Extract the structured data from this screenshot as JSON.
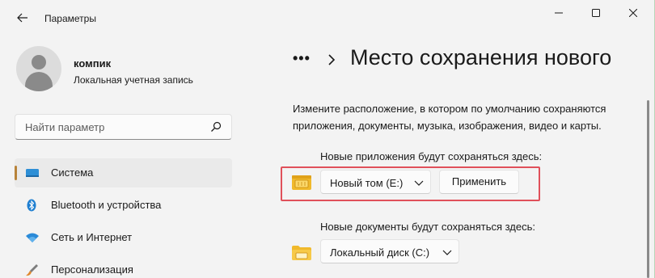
{
  "app": {
    "title": "Параметры"
  },
  "user": {
    "name": "компик",
    "account_type": "Локальная учетная запись"
  },
  "search": {
    "placeholder": "Найти параметр"
  },
  "sidebar": {
    "items": [
      {
        "label": "Система",
        "icon": "monitor-icon",
        "active": true
      },
      {
        "label": "Bluetooth и устройства",
        "icon": "bluetooth-icon",
        "active": false
      },
      {
        "label": "Сеть и Интернет",
        "icon": "wifi-icon",
        "active": false
      },
      {
        "label": "Персонализация",
        "icon": "brush-icon",
        "active": false
      }
    ]
  },
  "main": {
    "breadcrumb_overflow": "•••",
    "title": "Место сохранения нового",
    "description": "Измените расположение, в котором по умолчанию сохраняются приложения, документы, музыка, изображения, видео и карты.",
    "apps_section": {
      "label": "Новые приложения будут сохраняться здесь:",
      "selected_drive": "Новый том (E:)",
      "apply_label": "Применить"
    },
    "docs_section": {
      "label": "Новые документы будут сохраняться здесь:",
      "selected_drive": "Локальный диск (C:)"
    }
  },
  "colors": {
    "accent": "#b8833a",
    "highlight": "#e0505a",
    "folder": "#f0b92b"
  }
}
